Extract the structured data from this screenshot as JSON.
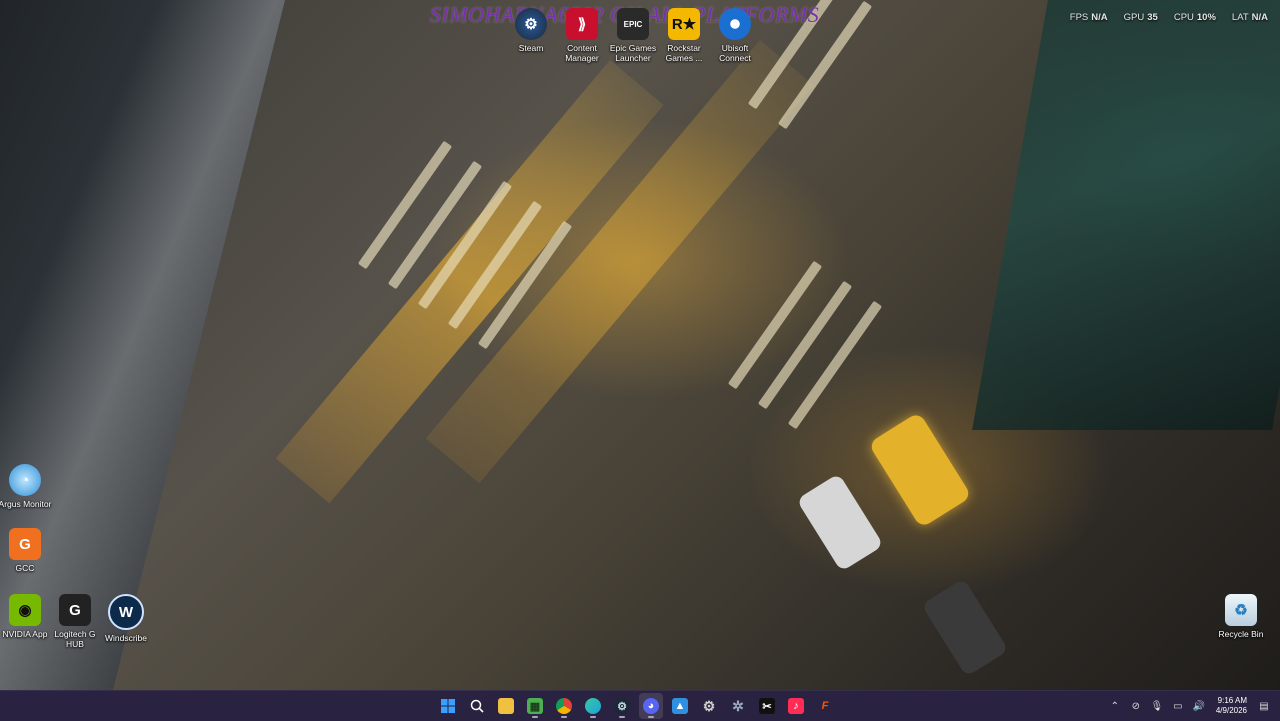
{
  "watermark": "SIMOHARNA6802 ON ALL PLATFORMS",
  "overlay_stats": [
    {
      "key": "FPS",
      "value": "N/A"
    },
    {
      "key": "GPU",
      "value": "35"
    },
    {
      "key": "CPU",
      "value": "10%"
    },
    {
      "key": "LAT",
      "value": "N/A"
    }
  ],
  "desktop_icons": {
    "steam": {
      "label": "Steam",
      "icon": "steam-icon",
      "color": "#1b2838"
    },
    "content_manager": {
      "label": "Content Manager",
      "icon": "content-manager-icon",
      "color": "#c8102e"
    },
    "epic_games": {
      "label": "Epic Games Launcher",
      "icon": "epic-games-icon",
      "color": "#2a2a2a"
    },
    "rockstar": {
      "label": "Rockstar Games ...",
      "icon": "rockstar-icon",
      "color": "#f5b800"
    },
    "ubisoft": {
      "label": "Ubisoft Connect",
      "icon": "ubisoft-icon",
      "color": "#1a6fd1"
    },
    "argus": {
      "label": "Argus Monitor",
      "icon": "argus-monitor-icon",
      "color": "#2e8fd6"
    },
    "gcc": {
      "label": "GCC",
      "icon": "gcc-icon",
      "color": "#f07020"
    },
    "nvidia": {
      "label": "NVIDIA App",
      "icon": "nvidia-icon",
      "color": "#76b900"
    },
    "logitech": {
      "label": "Logitech G HUB",
      "icon": "logitech-g-icon",
      "color": "#222222"
    },
    "windscribe": {
      "label": "Windscribe",
      "icon": "windscribe-icon",
      "color": "#0d2a4a"
    },
    "recycle_bin": {
      "label": "Recycle Bin",
      "icon": "recycle-bin-icon",
      "color": "#d8e6f0"
    }
  },
  "taskbar": {
    "clock": {
      "time": "9:16 AM",
      "date": "4/9/2026"
    },
    "apps": [
      {
        "name": "start",
        "icon": "windows-icon",
        "color": "#3aa0ff"
      },
      {
        "name": "search",
        "icon": "search-icon",
        "color": "#ffffff"
      },
      {
        "name": "file-explorer",
        "icon": "folder-icon",
        "color": "#f0c040"
      },
      {
        "name": "minecraft",
        "icon": "minecraft-icon",
        "color": "#4caf50"
      },
      {
        "name": "chrome",
        "icon": "chrome-icon",
        "color": "#db4437"
      },
      {
        "name": "edge",
        "icon": "edge-icon",
        "color": "#1fa3d8"
      },
      {
        "name": "steam",
        "icon": "steam-icon",
        "color": "#c7d5e0"
      },
      {
        "name": "discord",
        "icon": "discord-icon",
        "color": "#5865f2"
      },
      {
        "name": "photos",
        "icon": "photos-icon",
        "color": "#2f8fe0"
      },
      {
        "name": "settings",
        "icon": "gear-icon",
        "color": "#cfcfcf"
      },
      {
        "name": "settings-alt",
        "icon": "cog-icon",
        "color": "#9aa9bd"
      },
      {
        "name": "capcut",
        "icon": "capcut-icon",
        "color": "#ffffff"
      },
      {
        "name": "tiktok",
        "icon": "tiktok-icon",
        "color": "#ff2d55"
      },
      {
        "name": "faceit",
        "icon": "faceit-icon",
        "color": "#ff5500"
      }
    ],
    "tray": [
      "chevron-up-icon",
      "network-disabled-icon",
      "microphone-icon",
      "display-icon",
      "volume-icon",
      "battery-icon"
    ]
  }
}
